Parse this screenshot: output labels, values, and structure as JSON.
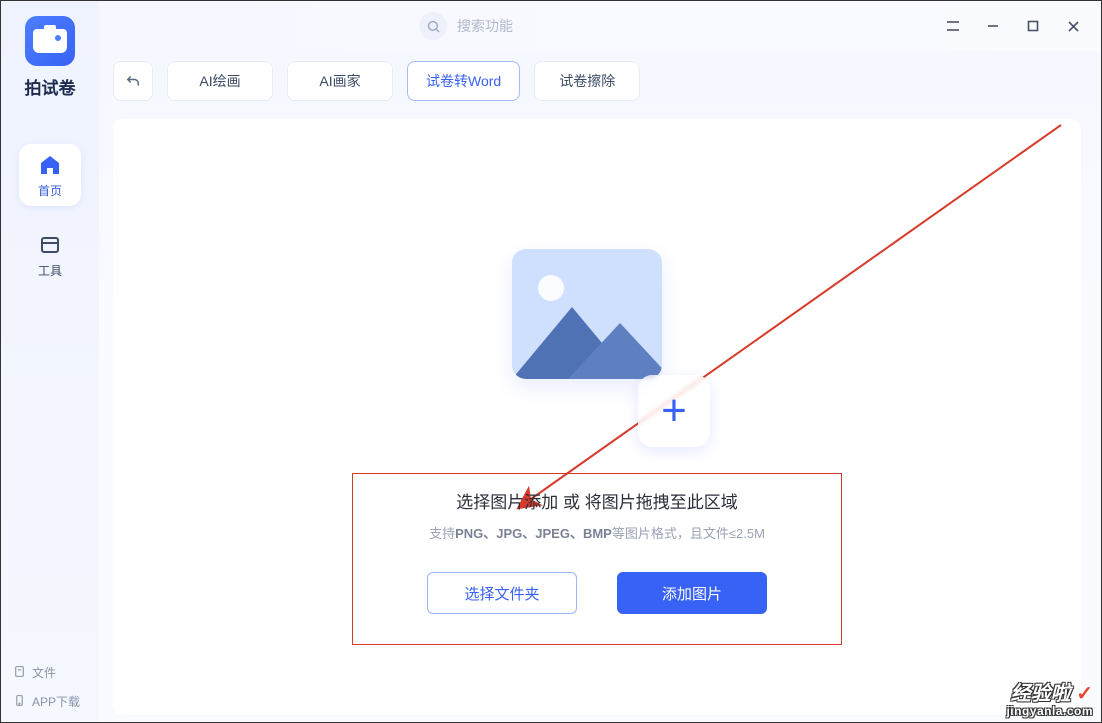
{
  "app": {
    "name": "拍试卷"
  },
  "sidebar": {
    "items": [
      {
        "label": "首页",
        "icon": "home-icon",
        "active": true
      },
      {
        "label": "工具",
        "icon": "tools-icon",
        "active": false
      }
    ],
    "bottom": [
      {
        "label": "文件",
        "icon": "file-icon"
      },
      {
        "label": "APP下载",
        "icon": "phone-icon"
      }
    ]
  },
  "topbar": {
    "search_placeholder": "搜索功能"
  },
  "tabs": {
    "items": [
      {
        "label": "AI绘画"
      },
      {
        "label": "AI画家"
      },
      {
        "label": "试卷转Word",
        "selected": true
      },
      {
        "label": "试卷擦除"
      }
    ]
  },
  "drop": {
    "title": "选择图片添加 或 将图片拖拽至此区域",
    "subtitle_prefix": "支持",
    "formats": "PNG、JPG、JPEG、BMP",
    "subtitle_suffix": "等图片格式，且文件≤2.5M",
    "choose_folder": "选择文件夹",
    "add_image": "添加图片"
  },
  "watermark": {
    "line1": "经验啦",
    "line2": "jingyanla.com"
  }
}
